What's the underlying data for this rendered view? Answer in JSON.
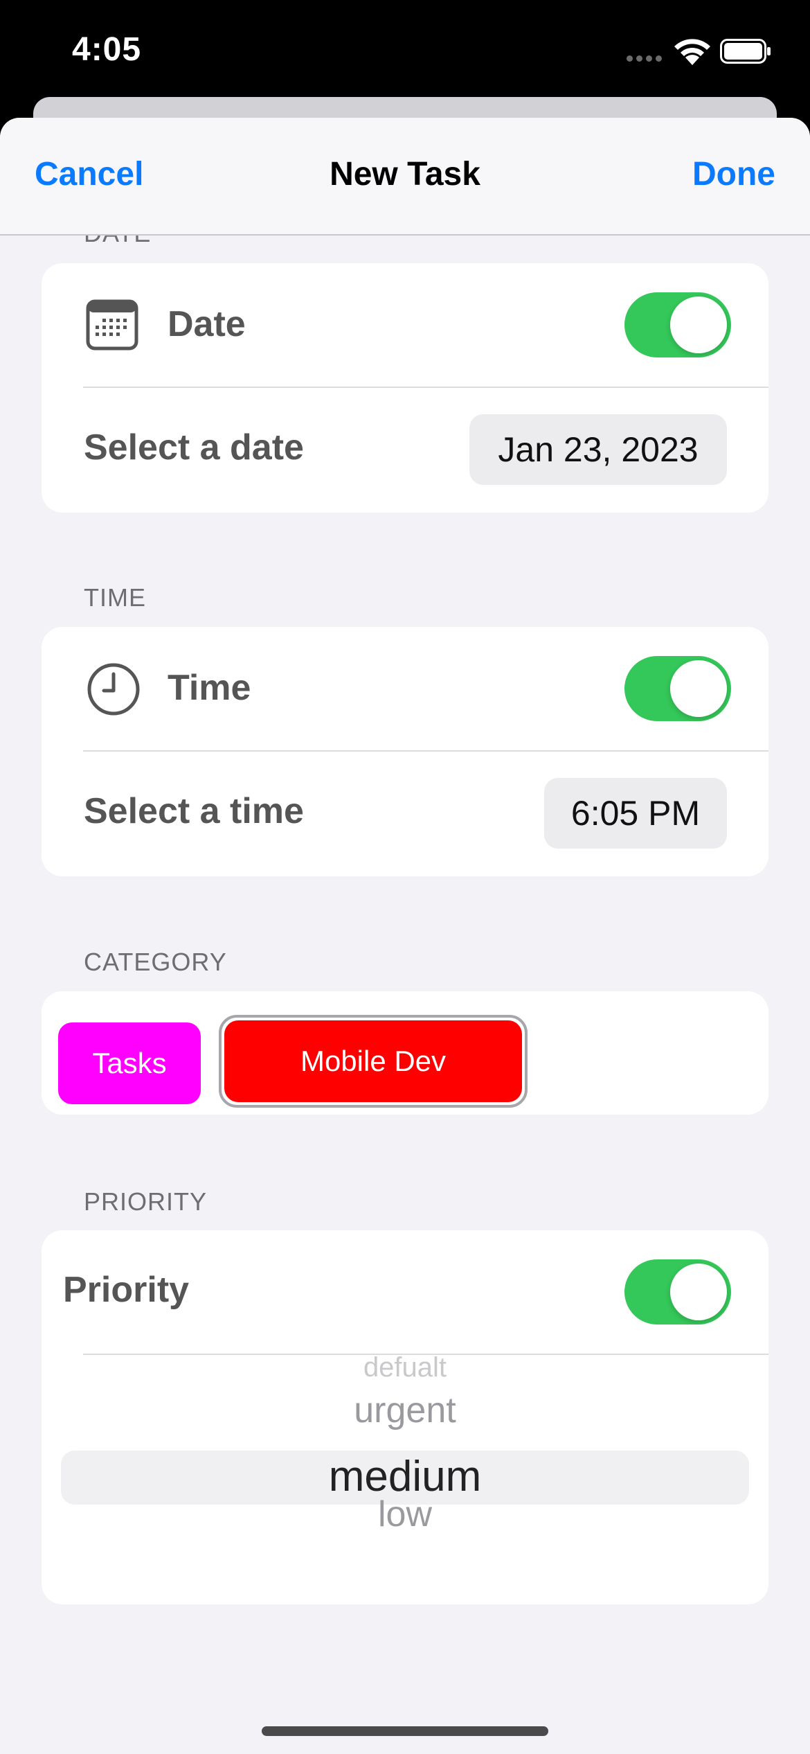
{
  "status_bar": {
    "time": "4:05"
  },
  "nav": {
    "cancel": "Cancel",
    "title": "New Task",
    "done": "Done"
  },
  "date_section": {
    "header": "DATE",
    "label": "Date",
    "toggle_on": true,
    "select_label": "Select a date",
    "value": "Jan 23, 2023"
  },
  "time_section": {
    "header": "TIME",
    "label": "Time",
    "toggle_on": true,
    "select_label": "Select a time",
    "value": "6:05 PM"
  },
  "category_section": {
    "header": "CATEGORY",
    "chips": [
      {
        "label": "Tasks",
        "color": "#ff00ff",
        "selected": false
      },
      {
        "label": "Mobile Dev",
        "color": "#ff0000",
        "selected": true
      }
    ]
  },
  "priority_section": {
    "header": "PRIORITY",
    "label": "Priority",
    "toggle_on": true,
    "options": [
      "defualt",
      "urgent",
      "medium",
      "low"
    ],
    "selected": "medium"
  },
  "colors": {
    "accent": "#0a7aff",
    "toggle_on": "#34c759"
  }
}
